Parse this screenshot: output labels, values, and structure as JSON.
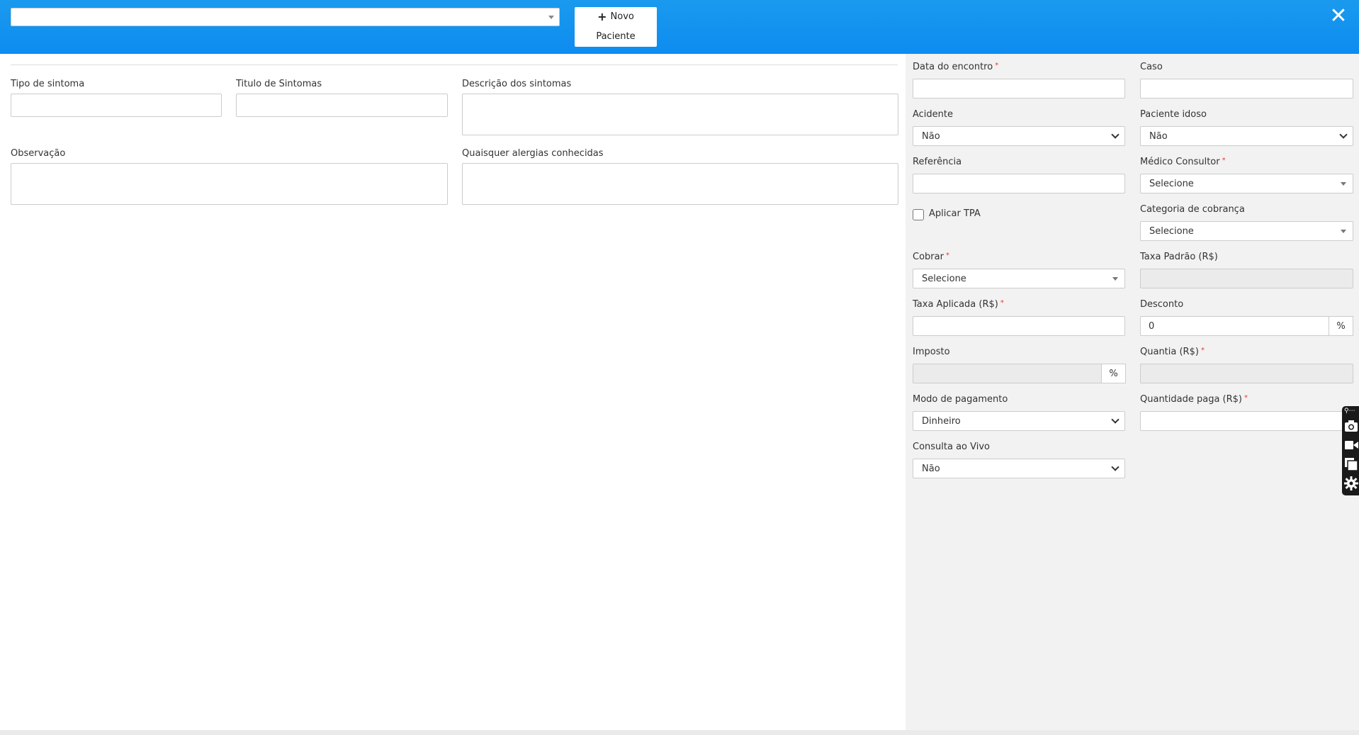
{
  "header": {
    "patient_select_value": "",
    "new_patient": {
      "line1": "Novo",
      "line2": "Paciente"
    }
  },
  "symptoms": {
    "tipo_label": "Tipo de sintoma",
    "titulo_label": "Titulo de Sintomas",
    "descricao_label": "Descrição dos sintomas",
    "observacao_label": "Observação",
    "alergias_label": "Quaisquer alergias conhecidas"
  },
  "billing": {
    "data_encontro_label": "Data do encontro",
    "caso_label": "Caso",
    "acidente_label": "Acidente",
    "acidente_value": "Não",
    "paciente_idoso_label": "Paciente idoso",
    "paciente_idoso_value": "Não",
    "referencia_label": "Referência",
    "medico_label": "Médico Consultor",
    "medico_value": "Selecione",
    "aplicar_tpa_label": "Aplicar TPA",
    "categoria_label": "Categoria de cobrança",
    "categoria_value": "Selecione",
    "cobrar_label": "Cobrar",
    "cobrar_value": "Selecione",
    "taxa_padrao_label": "Taxa Padrão (R$)",
    "taxa_aplicada_label": "Taxa Aplicada (R$)",
    "desconto_label": "Desconto",
    "desconto_value": "0",
    "percent_symbol": "%",
    "imposto_label": "Imposto",
    "quantia_label": "Quantia (R$)",
    "modo_pagamento_label": "Modo de pagamento",
    "modo_pagamento_value": "Dinheiro",
    "quantidade_paga_label": "Quantidade paga (R$)",
    "consulta_vivo_label": "Consulta ao Vivo",
    "consulta_vivo_value": "Não",
    "required_mark": "*"
  },
  "toolbar": {
    "top_label": "⚲⋯"
  },
  "colors": {
    "header": "#0d8cf0",
    "required": "#e53935",
    "panel": "#f2f2f2"
  }
}
